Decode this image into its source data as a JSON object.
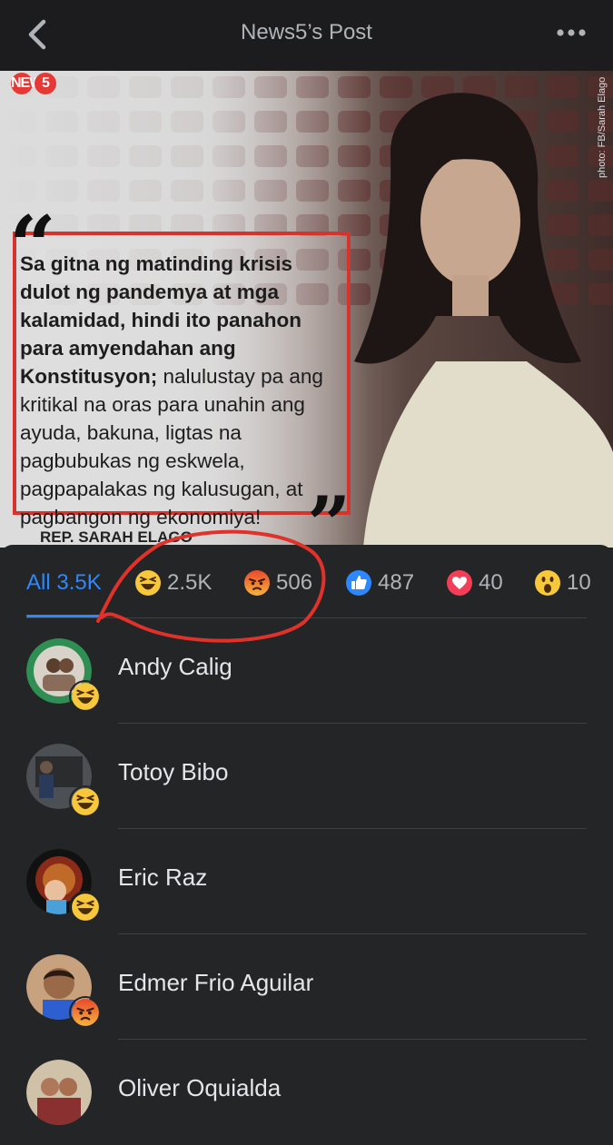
{
  "header": {
    "title": "News5’s Post"
  },
  "post": {
    "logo": "NEWS",
    "logo_badge": "5",
    "photo_credit": "photo: FB/Sarah Elago",
    "quote_bold": "Sa gitna ng matinding krisis dulot ng pandemya at mga kalamidad, hindi ito panahon para amyendahan ang Konstitusyon;",
    "quote_rest": "nalulustay pa ang kritikal na oras para unahin ang ayuda, bakuna, ligtas na pagbubukas ng eskwela, pagpapalakas ng kalusugan, at pagbangon ng ekonomiya!",
    "author": "REP. SARAH ELAGO"
  },
  "tabs": [
    {
      "label": "All 3.5K",
      "icon": "none"
    },
    {
      "label": "2.5K",
      "icon": "haha-icon"
    },
    {
      "label": "506",
      "icon": "angry-icon"
    },
    {
      "label": "487",
      "icon": "like-icon"
    },
    {
      "label": "40",
      "icon": "love-icon"
    },
    {
      "label": "10",
      "icon": "wow-icon"
    }
  ],
  "reactors": [
    {
      "name": "Andy Calig",
      "reaction": "haha-icon"
    },
    {
      "name": "Totoy Bibo",
      "reaction": "haha-icon"
    },
    {
      "name": "Eric Raz",
      "reaction": "haha-icon"
    },
    {
      "name": "Edmer Frio Aguilar",
      "reaction": "angry-icon"
    },
    {
      "name": "Oliver Oquialda",
      "reaction": "haha-icon"
    }
  ],
  "colors": {
    "accent": "#2d88ff",
    "background": "#242526",
    "annotation": "#e0322a"
  }
}
